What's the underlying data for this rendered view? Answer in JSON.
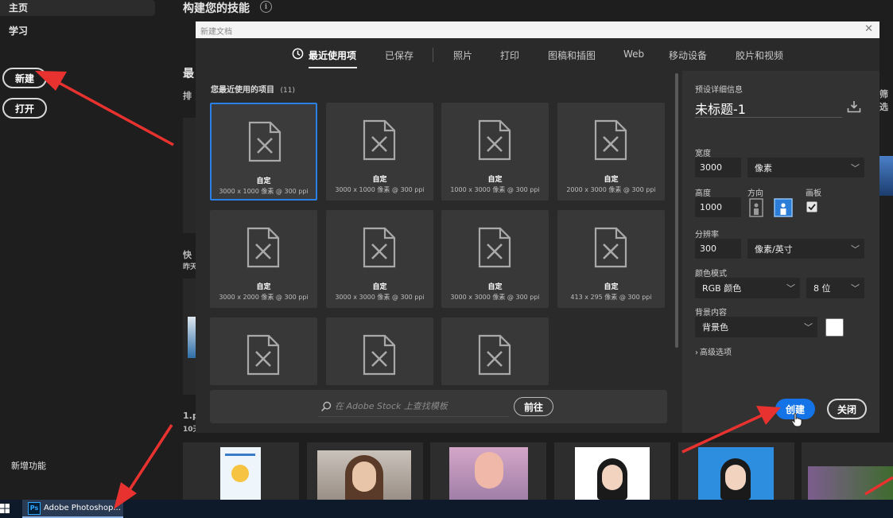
{
  "sidebar": {
    "home": "主页",
    "learn": "学习",
    "new_button": "新建",
    "open_button": "打开",
    "new_features": "新增功能"
  },
  "home": {
    "heading": "构建您的技能",
    "recent_heading_partial": "最",
    "sort_partial": "排",
    "quick_partial": "快",
    "yesterday_partial": "昨天",
    "file_partial": "1.p",
    "days_partial": "10天",
    "filter_partial": "筛选"
  },
  "dialog": {
    "title": "新建文档",
    "tabs": [
      {
        "label": "最近使用项",
        "active": true
      },
      {
        "label": "已保存"
      },
      {
        "label": "照片"
      },
      {
        "label": "打印"
      },
      {
        "label": "图稿和插图"
      },
      {
        "label": "Web"
      },
      {
        "label": "移动设备"
      },
      {
        "label": "胶片和视频"
      }
    ],
    "recent_title": "您最近使用的项目",
    "recent_count": "(11)",
    "presets": [
      {
        "label": "自定",
        "size": "3000 x 1000 像素 @ 300 ppi",
        "selected": true
      },
      {
        "label": "自定",
        "size": "3000 x 1000 像素 @ 300 ppi"
      },
      {
        "label": "自定",
        "size": "1000 x 3000 像素 @ 300 ppi"
      },
      {
        "label": "自定",
        "size": "2000 x 3000 像素 @ 300 ppi"
      },
      {
        "label": "自定",
        "size": "3000 x 2000 像素 @ 300 ppi"
      },
      {
        "label": "自定",
        "size": "3000 x 3000 像素 @ 300 ppi"
      },
      {
        "label": "自定",
        "size": "3000 x 3000 像素 @ 300 ppi"
      },
      {
        "label": "自定",
        "size": "413 x 295 像素 @ 300 ppi"
      },
      {
        "label": "",
        "size": ""
      },
      {
        "label": "",
        "size": ""
      },
      {
        "label": "",
        "size": ""
      }
    ],
    "search_placeholder": "在 Adobe Stock 上查找模板",
    "goto_button": "前往",
    "details": {
      "section_title": "预设详细信息",
      "doc_name": "未标题-1",
      "width_label": "宽度",
      "width_value": "3000",
      "width_unit": "像素",
      "height_label": "高度",
      "height_value": "1000",
      "orientation_label": "方向",
      "artboard_label": "画板",
      "artboard_checked": true,
      "resolution_label": "分辨率",
      "resolution_value": "300",
      "resolution_unit": "像素/英寸",
      "color_mode_label": "颜色模式",
      "color_mode_value": "RGB 颜色",
      "bit_depth_value": "8 位",
      "background_label": "背景内容",
      "background_value": "背景色",
      "background_swatch": "#ffffff",
      "advanced_label": "高级选项",
      "create_button": "创建",
      "close_button": "关闭"
    }
  },
  "taskbar": {
    "app_icon_text": "Ps",
    "app_label": "Adobe Photoshop..."
  },
  "colors": {
    "accent": "#1473e6",
    "annotation_arrow": "#e8322f"
  }
}
